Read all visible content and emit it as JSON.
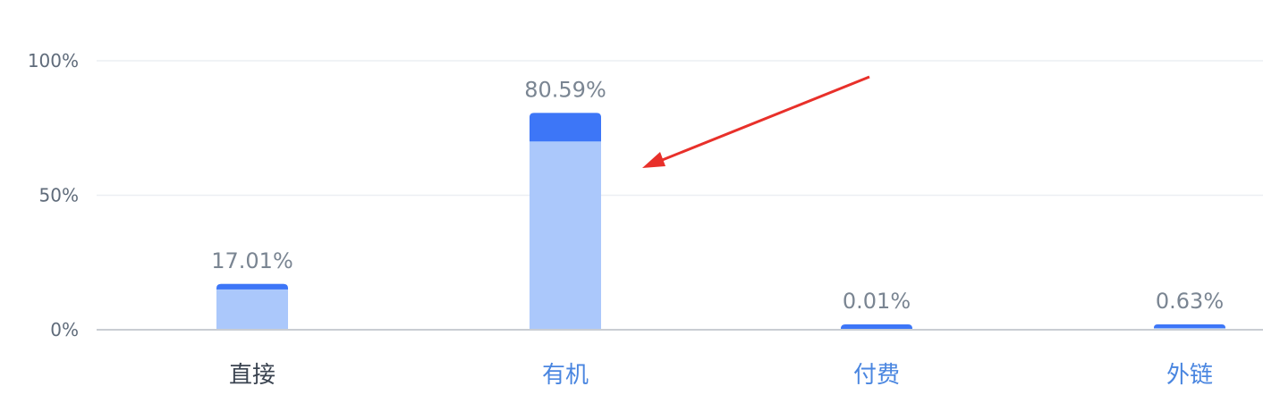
{
  "chart_data": {
    "type": "bar",
    "categories": [
      "直接",
      "有机",
      "付费",
      "外链"
    ],
    "series": [
      {
        "values": [
          17.01,
          80.59,
          0.01,
          0.63
        ]
      }
    ],
    "value_labels": [
      "17.01%",
      "80.59%",
      "0.01%",
      "0.63%"
    ],
    "inner_values": [
      15.0,
      70.0,
      0.01,
      0.63
    ],
    "y_ticks": [
      "0%",
      "50%",
      "100%"
    ],
    "ylim": [
      0,
      100
    ],
    "grid": true,
    "selected_category": "直接"
  },
  "colors": {
    "bar_fill": "#abc8fb",
    "bar_top": "#3d76f7",
    "category_selected": "#3a4350",
    "category_link": "#4a86e0",
    "gridline": "#eceff3",
    "axis": "#c9cdd3",
    "annotation_arrow": "#e8302a"
  }
}
